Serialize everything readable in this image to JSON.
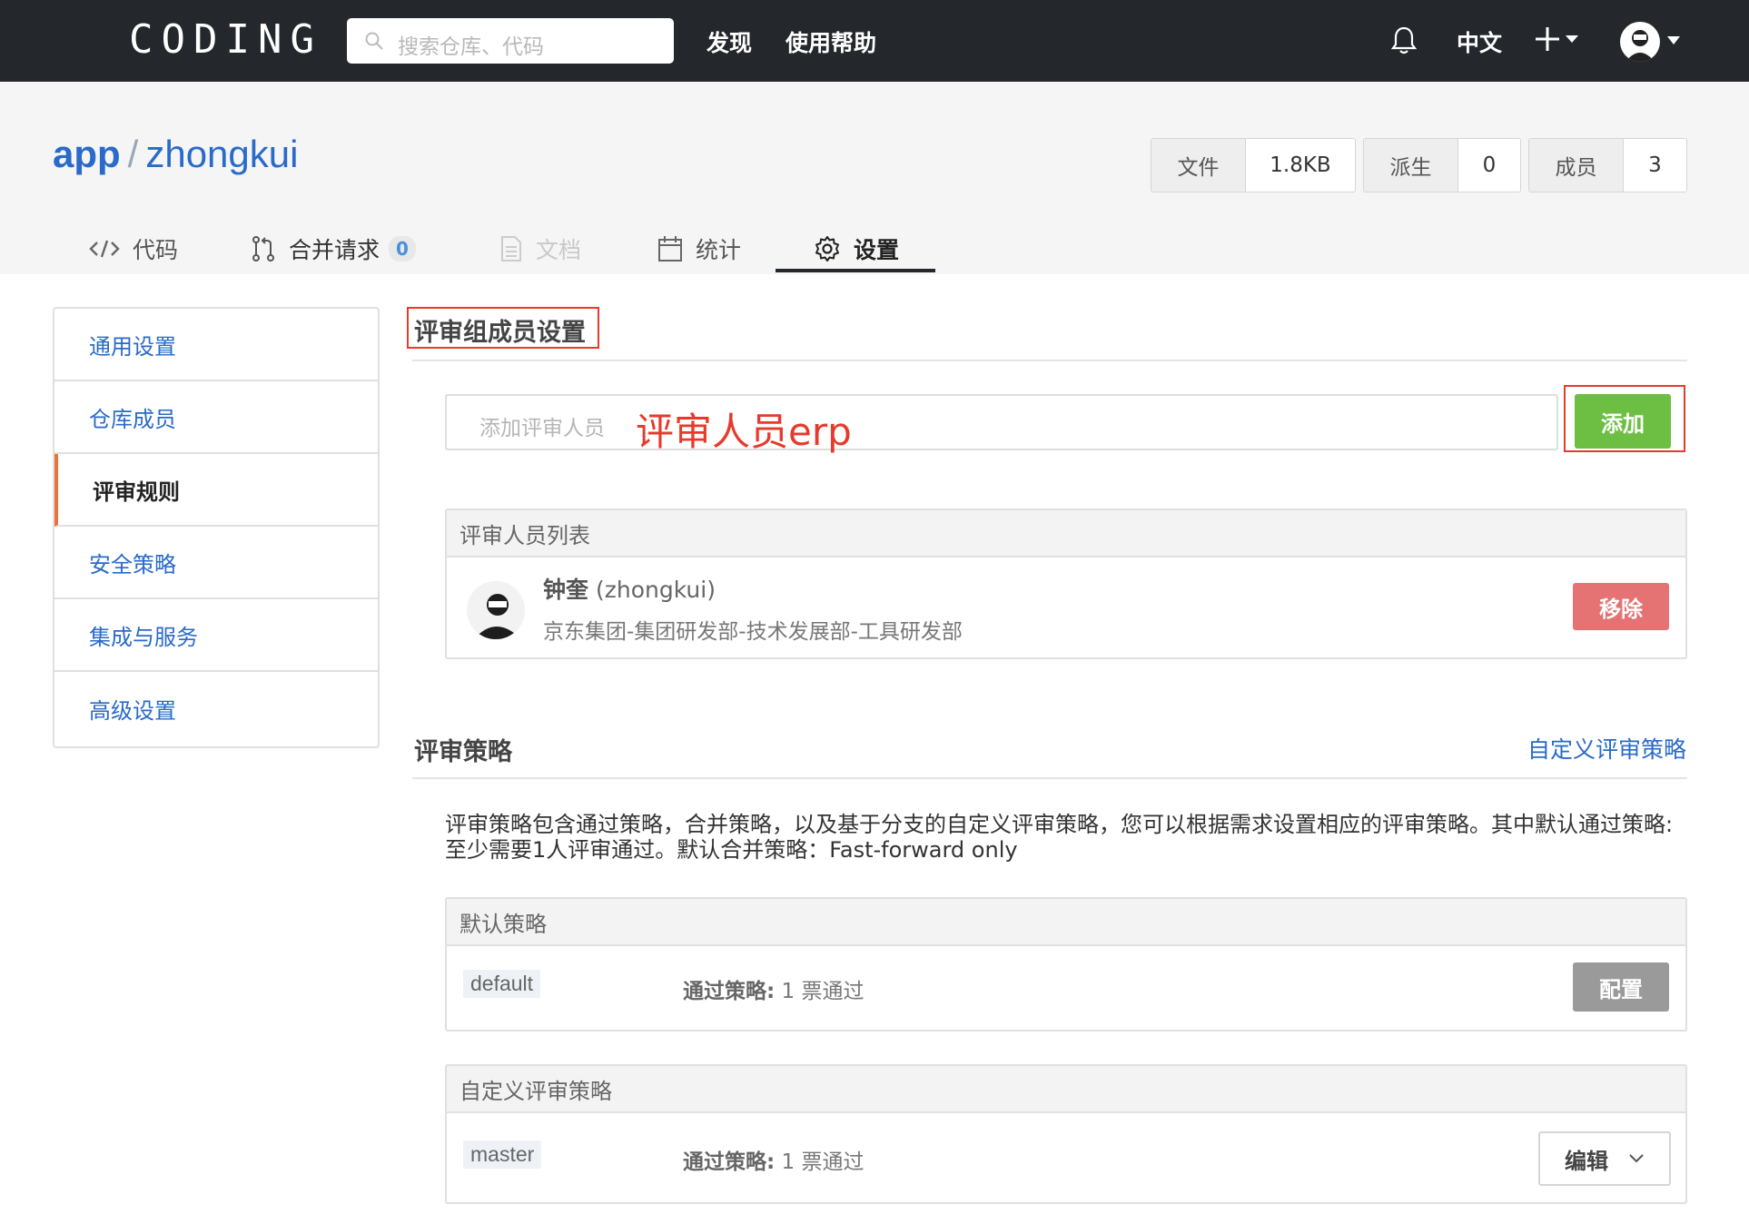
{
  "topbar": {
    "logo": "CODING",
    "search_placeholder": "搜索仓库、代码",
    "nav": [
      "发现",
      "使用帮助"
    ],
    "lang": "中文"
  },
  "repo": {
    "owner": "app",
    "separator": "/",
    "name": "zhongkui",
    "stats": [
      {
        "label": "文件",
        "value": "1.8KB"
      },
      {
        "label": "派生",
        "value": "0"
      },
      {
        "label": "成员",
        "value": "3"
      }
    ]
  },
  "tabs": [
    {
      "label": "代码",
      "icon": "code-icon"
    },
    {
      "label": "合并请求",
      "icon": "merge-request-icon",
      "badge": "0"
    },
    {
      "label": "文档",
      "icon": "document-icon",
      "disabled": true
    },
    {
      "label": "统计",
      "icon": "calendar-icon"
    },
    {
      "label": "设置",
      "icon": "gear-icon",
      "active": true
    }
  ],
  "sidebar": {
    "items": [
      {
        "label": "通用设置"
      },
      {
        "label": "仓库成员"
      },
      {
        "label": "评审规则",
        "active": true
      },
      {
        "label": "安全策略"
      },
      {
        "label": "集成与服务"
      },
      {
        "label": "高级设置"
      }
    ]
  },
  "reviewers": {
    "title": "评审组成员设置",
    "input_placeholder": "添加评审人员",
    "input_value": "评审人员erp",
    "add_label": "添加",
    "list_title": "评审人员列表",
    "member": {
      "name": "钟奎",
      "login": "(zhongkui)",
      "org": "京东集团-集团研发部-技术发展部-工具研发部"
    },
    "remove_label": "移除"
  },
  "strategy": {
    "title": "评审策略",
    "custom_link": "自定义评审策略",
    "description": "评审策略包含通过策略，合并策略，以及基于分支的自定义评审策略，您可以根据需求设置相应的评审策略。其中默认通过策略:至少需要1人评审通过。默认合并策略：Fast-forward only",
    "default_panel": {
      "title": "默认策略",
      "branch": "default",
      "policy_label": "通过策略:",
      "policy_value": "1 票通过",
      "button": "配置"
    },
    "custom_panel": {
      "title": "自定义评审策略",
      "branch": "master",
      "policy_label": "通过策略:",
      "policy_value": "1 票通过",
      "button": "编辑"
    }
  },
  "colors": {
    "topbar": "#24272b",
    "link": "#2a6ac9",
    "accent_orange": "#e8743a",
    "annotation_red": "#e53b2c",
    "add_green": "#6cbf43",
    "remove_red": "#e57373"
  }
}
